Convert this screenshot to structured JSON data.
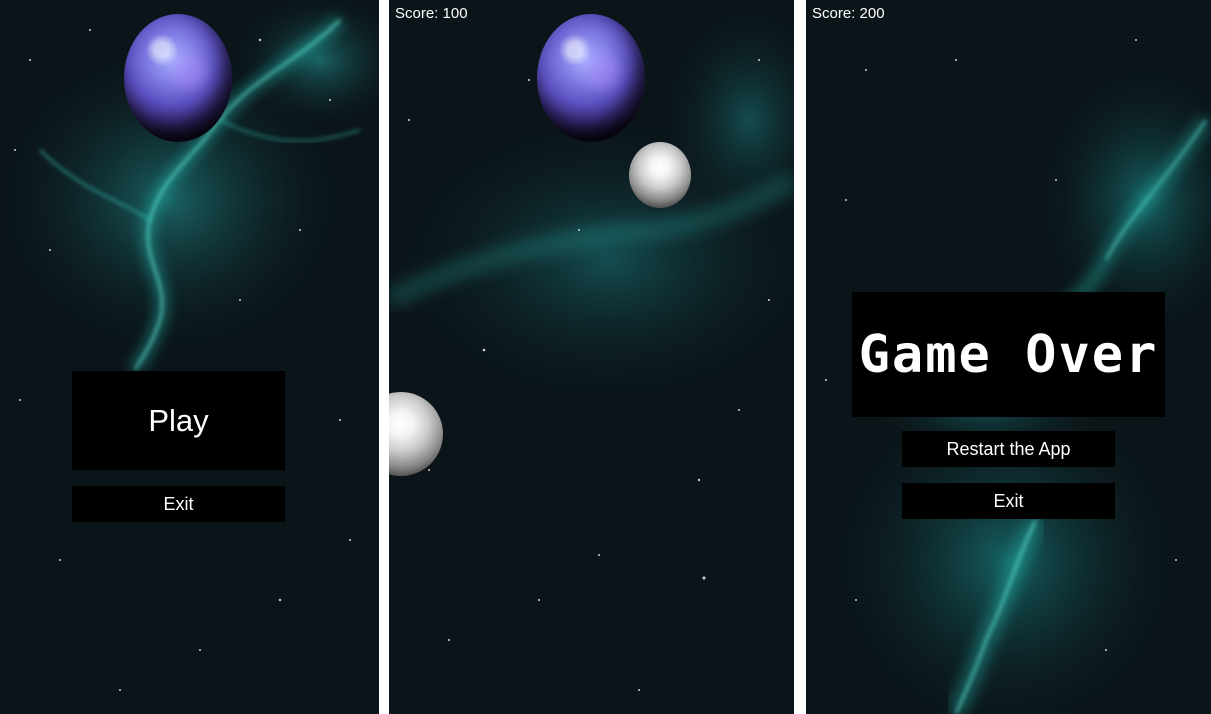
{
  "menu_screen": {
    "play_label": "Play",
    "exit_label": "Exit"
  },
  "game_screen": {
    "score": "Score: 100"
  },
  "game_over_screen": {
    "score": "Score: 200",
    "title": "Game Over",
    "restart_label": "Restart the App",
    "exit_label": "Exit"
  },
  "colors": {
    "background": "#0b1519",
    "nebula": "#1fd6c8",
    "button": "#000000",
    "text": "#ffffff",
    "planet": "#6a5fd0"
  }
}
